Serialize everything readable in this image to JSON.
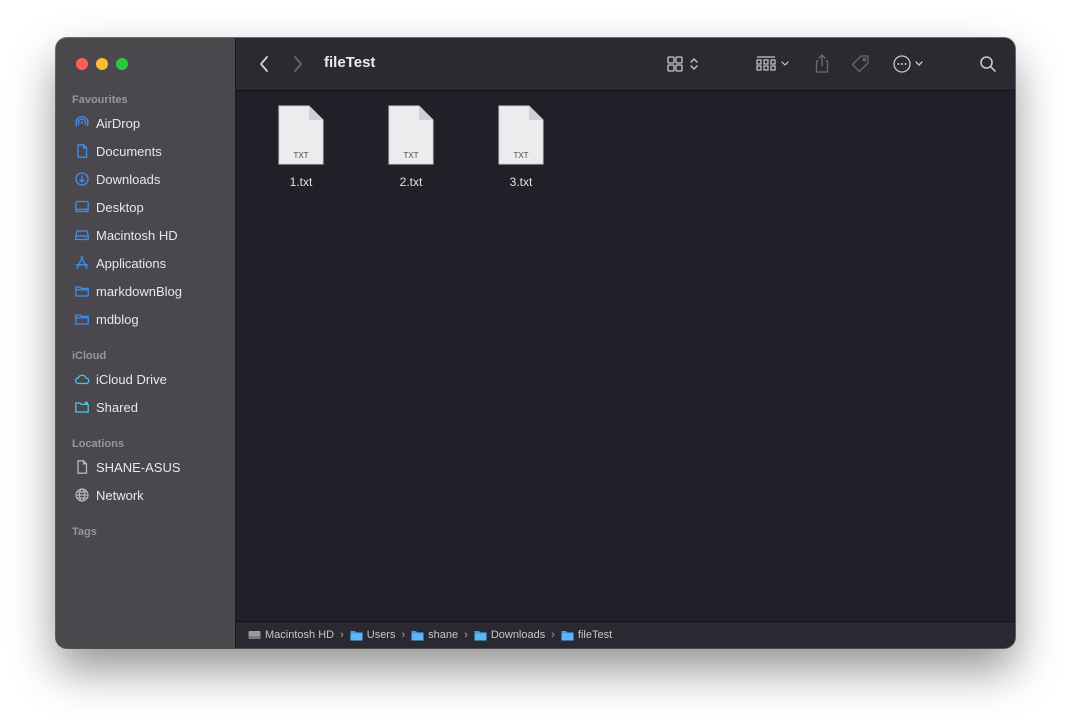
{
  "window": {
    "title": "fileTest"
  },
  "sidebar": {
    "sections": [
      {
        "title": "Favourites",
        "items": [
          {
            "label": "AirDrop",
            "icon": "airdrop-icon"
          },
          {
            "label": "Documents",
            "icon": "document-icon"
          },
          {
            "label": "Downloads",
            "icon": "download-icon"
          },
          {
            "label": "Desktop",
            "icon": "desktop-icon"
          },
          {
            "label": "Macintosh HD",
            "icon": "drive-icon"
          },
          {
            "label": "Applications",
            "icon": "applications-icon"
          },
          {
            "label": "markdownBlog",
            "icon": "folder-icon"
          },
          {
            "label": "mdblog",
            "icon": "folder-icon"
          }
        ]
      },
      {
        "title": "iCloud",
        "items": [
          {
            "label": "iCloud Drive",
            "icon": "cloud-icon"
          },
          {
            "label": "Shared",
            "icon": "shared-folder-icon"
          }
        ]
      },
      {
        "title": "Locations",
        "items": [
          {
            "label": "SHANE-ASUS",
            "icon": "document-icon"
          },
          {
            "label": "Network",
            "icon": "globe-icon"
          }
        ]
      },
      {
        "title": "Tags",
        "items": []
      }
    ]
  },
  "files": [
    {
      "name": "1.txt",
      "kind": "TXT"
    },
    {
      "name": "2.txt",
      "kind": "TXT"
    },
    {
      "name": "3.txt",
      "kind": "TXT"
    }
  ],
  "pathbar": [
    {
      "label": "Macintosh HD",
      "icon": "drive-icon"
    },
    {
      "label": "Users",
      "icon": "folder-icon"
    },
    {
      "label": "shane",
      "icon": "folder-icon"
    },
    {
      "label": "Downloads",
      "icon": "folder-icon"
    },
    {
      "label": "fileTest",
      "icon": "folder-icon"
    }
  ],
  "pathbar_separator": "›",
  "colors": {
    "accent_blue": "#3b8ef5",
    "close": "#fe5f57",
    "minimize": "#febc2e",
    "maximize": "#28c840"
  }
}
